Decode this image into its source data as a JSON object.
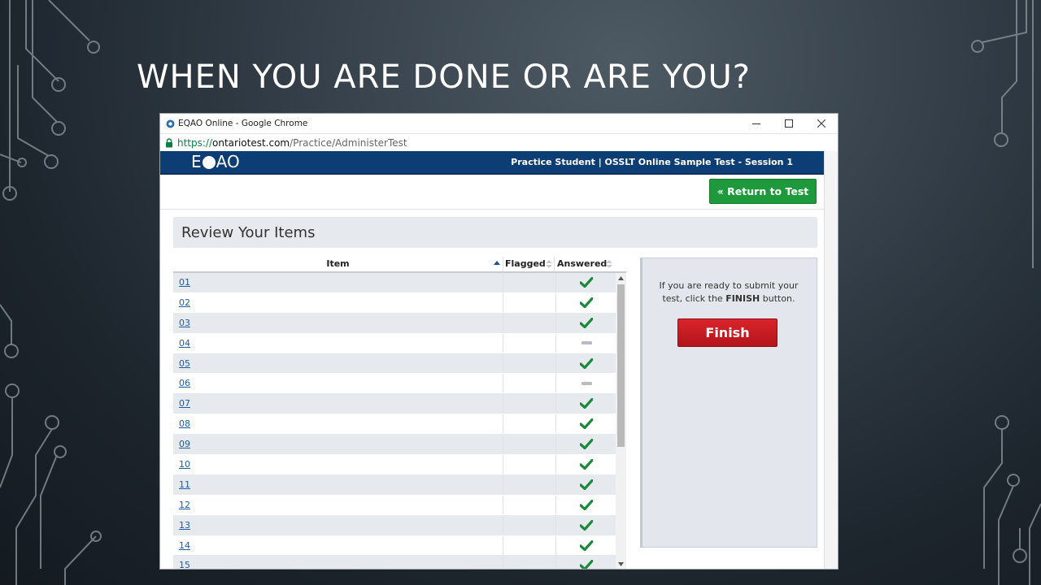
{
  "slide": {
    "title": "WHEN YOU ARE DONE OR ARE YOU?"
  },
  "browser": {
    "window_title": "EQAO Online - Google Chrome",
    "url_scheme": "https://",
    "url_host": "ontariotest.com",
    "url_path": "/Practice/AdministerTest"
  },
  "app": {
    "logo_left": "E",
    "logo_right": "AO",
    "header_info": "Practice Student | OSSLT Online Sample Test - Session 1",
    "return_label": "« Return to Test",
    "review_title": "Review Your Items"
  },
  "table": {
    "columns": {
      "item": "Item",
      "flagged": "Flagged",
      "answered": "Answered"
    },
    "rows": [
      {
        "item": "01",
        "answered": true
      },
      {
        "item": "02",
        "answered": true
      },
      {
        "item": "03",
        "answered": true
      },
      {
        "item": "04",
        "answered": false
      },
      {
        "item": "05",
        "answered": true
      },
      {
        "item": "06",
        "answered": false
      },
      {
        "item": "07",
        "answered": true
      },
      {
        "item": "08",
        "answered": true
      },
      {
        "item": "09",
        "answered": true
      },
      {
        "item": "10",
        "answered": true
      },
      {
        "item": "11",
        "answered": true
      },
      {
        "item": "12",
        "answered": true
      },
      {
        "item": "13",
        "answered": true
      },
      {
        "item": "14",
        "answered": true
      },
      {
        "item": "15",
        "answered": true
      }
    ]
  },
  "finish_panel": {
    "text_1": "If you are ready to submit your test, click the ",
    "text_bold": "FINISH",
    "text_2": " button.",
    "finish_label": "Finish"
  },
  "colors": {
    "header_bg": "#0c3d74",
    "return_green": "#1e9a3c",
    "finish_red": "#c91c22",
    "check_green": "#1a8a3a",
    "link_blue": "#1a5ea8"
  }
}
